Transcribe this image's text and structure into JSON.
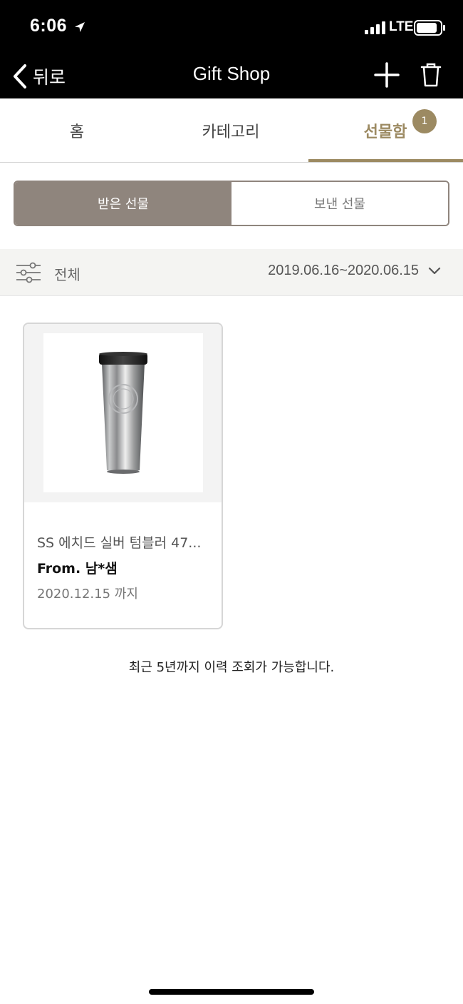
{
  "status_bar": {
    "time": "6:06",
    "network": "LTE"
  },
  "nav": {
    "back_label": "뒤로",
    "title": "Gift Shop"
  },
  "tabs": [
    {
      "label": "홈"
    },
    {
      "label": "카테고리"
    },
    {
      "label": "선물함",
      "badge": "1"
    }
  ],
  "segment": {
    "received": "받은 선물",
    "sent": "보낸 선물"
  },
  "filter": {
    "label": "전체",
    "date_range": "2019.06.16~2020.06.15"
  },
  "gifts": [
    {
      "name": "SS 에치드 실버 텀블러 47...",
      "from": "From. 남*샘",
      "expiry": "2020.12.15 까지"
    }
  ],
  "history_note": "최근 5년까지 이력 조회가 가능합니다.",
  "colors": {
    "accent": "#9c8a62",
    "segment_active": "#8f857d",
    "filter_bg": "#f4f4f2"
  }
}
